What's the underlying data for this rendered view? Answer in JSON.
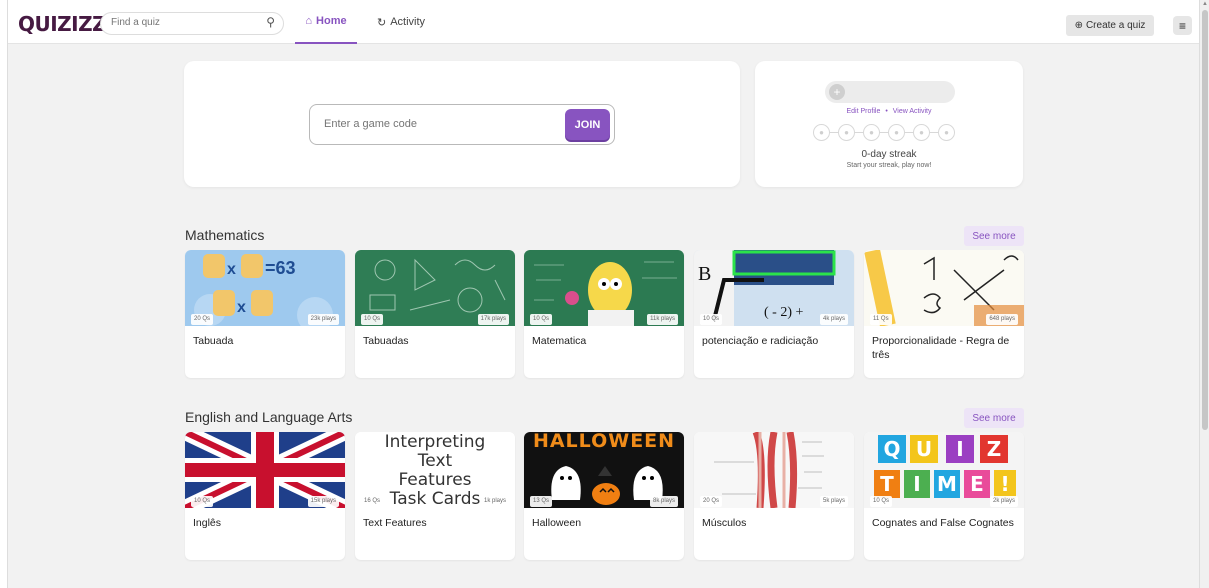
{
  "header": {
    "logo": "QUIZIZZ",
    "search_placeholder": "Find a quiz",
    "nav": [
      {
        "label": "Home",
        "icon": "home-icon"
      },
      {
        "label": "Activity",
        "icon": "history-icon"
      }
    ],
    "create_label": "Create a quiz",
    "menu_icon": "hamburger-icon"
  },
  "join": {
    "placeholder": "Enter a game code",
    "button_label": "JOIN"
  },
  "profile": {
    "edit_link": "Edit Profile",
    "separator": "•",
    "activity_link": "View Activity",
    "streak_title": "0-day streak",
    "streak_subtitle": "Start your streak, play now!"
  },
  "sections": [
    {
      "title": "Mathematics",
      "see_more": "See more",
      "quizzes": [
        {
          "title": "Tabuada",
          "questions": "20 Qs",
          "plays": "23k plays"
        },
        {
          "title": "Tabuadas",
          "questions": "10 Qs",
          "plays": "17k plays"
        },
        {
          "title": "Matematica",
          "questions": "10 Qs",
          "plays": "11k plays"
        },
        {
          "title": "potenciação e radiciação",
          "questions": "10 Qs",
          "plays": "4k plays"
        },
        {
          "title": "Proporcionalidade - Regra de três",
          "questions": "11 Qs",
          "plays": "648 plays"
        }
      ]
    },
    {
      "title": "English and Language Arts",
      "see_more": "See more",
      "quizzes": [
        {
          "title": "Inglês",
          "questions": "10 Qs",
          "plays": "15k plays"
        },
        {
          "title": "Text Features",
          "questions": "16 Qs",
          "plays": "1k plays",
          "image_text": [
            "Interpreting",
            "Text",
            "Features",
            "Task Cards"
          ]
        },
        {
          "title": "Halloween",
          "questions": "13 Qs",
          "plays": "8k plays",
          "image_text": [
            "HALLOWEEN"
          ]
        },
        {
          "title": "Músculos",
          "questions": "20 Qs",
          "plays": "5k plays"
        },
        {
          "title": "Cognates and False Cognates",
          "questions": "10 Qs",
          "plays": "2k plays",
          "image_text": [
            "Q",
            "U",
            "I",
            "Z",
            "T",
            "I",
            "M",
            "E",
            "!"
          ]
        }
      ]
    }
  ],
  "colors": {
    "accent": "#8854c0",
    "logo": "#461a42",
    "background": "#f2f2f2"
  }
}
